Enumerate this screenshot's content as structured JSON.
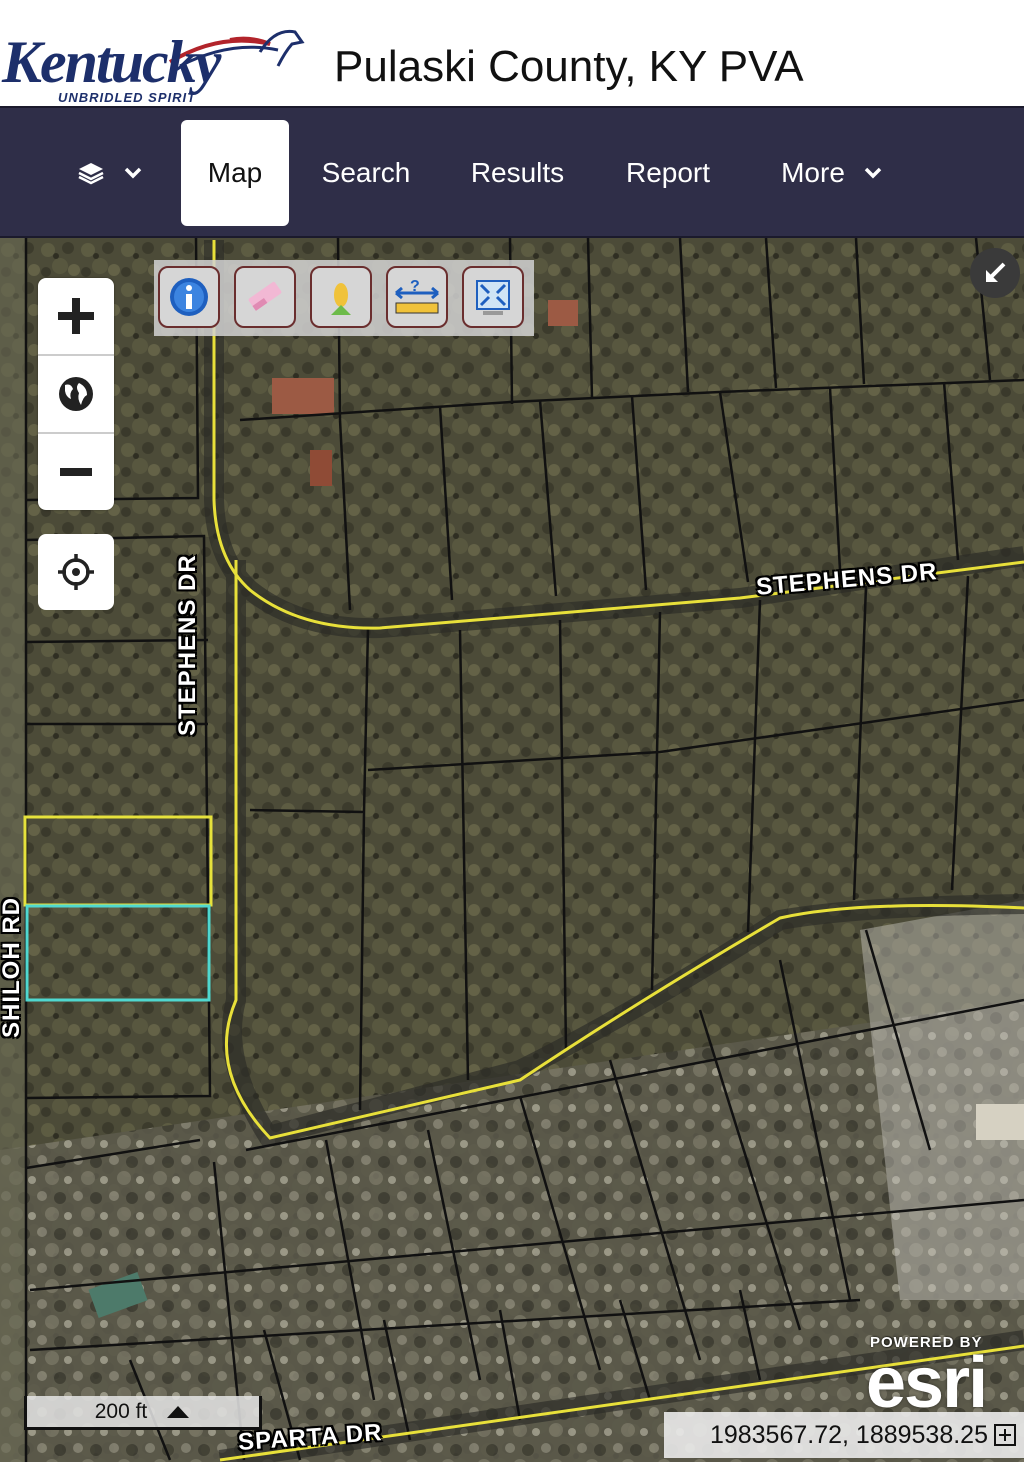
{
  "header": {
    "logo_word": "Kentucky",
    "logo_tagline": "UNBRIDLED SPIRIT",
    "title": "Pulaski County, KY PVA"
  },
  "nav": {
    "layers_icon": "layers-icon",
    "tabs": [
      {
        "label": "Map",
        "active": true
      },
      {
        "label": "Search"
      },
      {
        "label": "Results"
      },
      {
        "label": "Report"
      },
      {
        "label": "More"
      }
    ]
  },
  "map": {
    "tools": [
      "info-icon",
      "eraser-icon",
      "pin-icon",
      "measure-icon",
      "full-extent-icon"
    ],
    "zoom_controls": [
      "zoom-in-icon",
      "globe-icon",
      "zoom-out-icon"
    ],
    "roads": {
      "stephens_dr_vertical": "STEPHENS DR",
      "stephens_dr": "STEPHENS DR",
      "shiloh_rd": "SHILOH RD",
      "sparta_dr": "SPARTA DR"
    },
    "scale_label": "200 ft",
    "esri_powered": "POWERED BY",
    "esri_word": "esri",
    "coordinates": "1983567.72, 1889538.25",
    "colors": {
      "nav_bg": "#2f2e48",
      "road_line": "#e8e03a",
      "parcel_line": "#111111",
      "selected_parcel_yellow": "#e6e23c",
      "selected_parcel_cyan": "#4fd8d0"
    }
  }
}
